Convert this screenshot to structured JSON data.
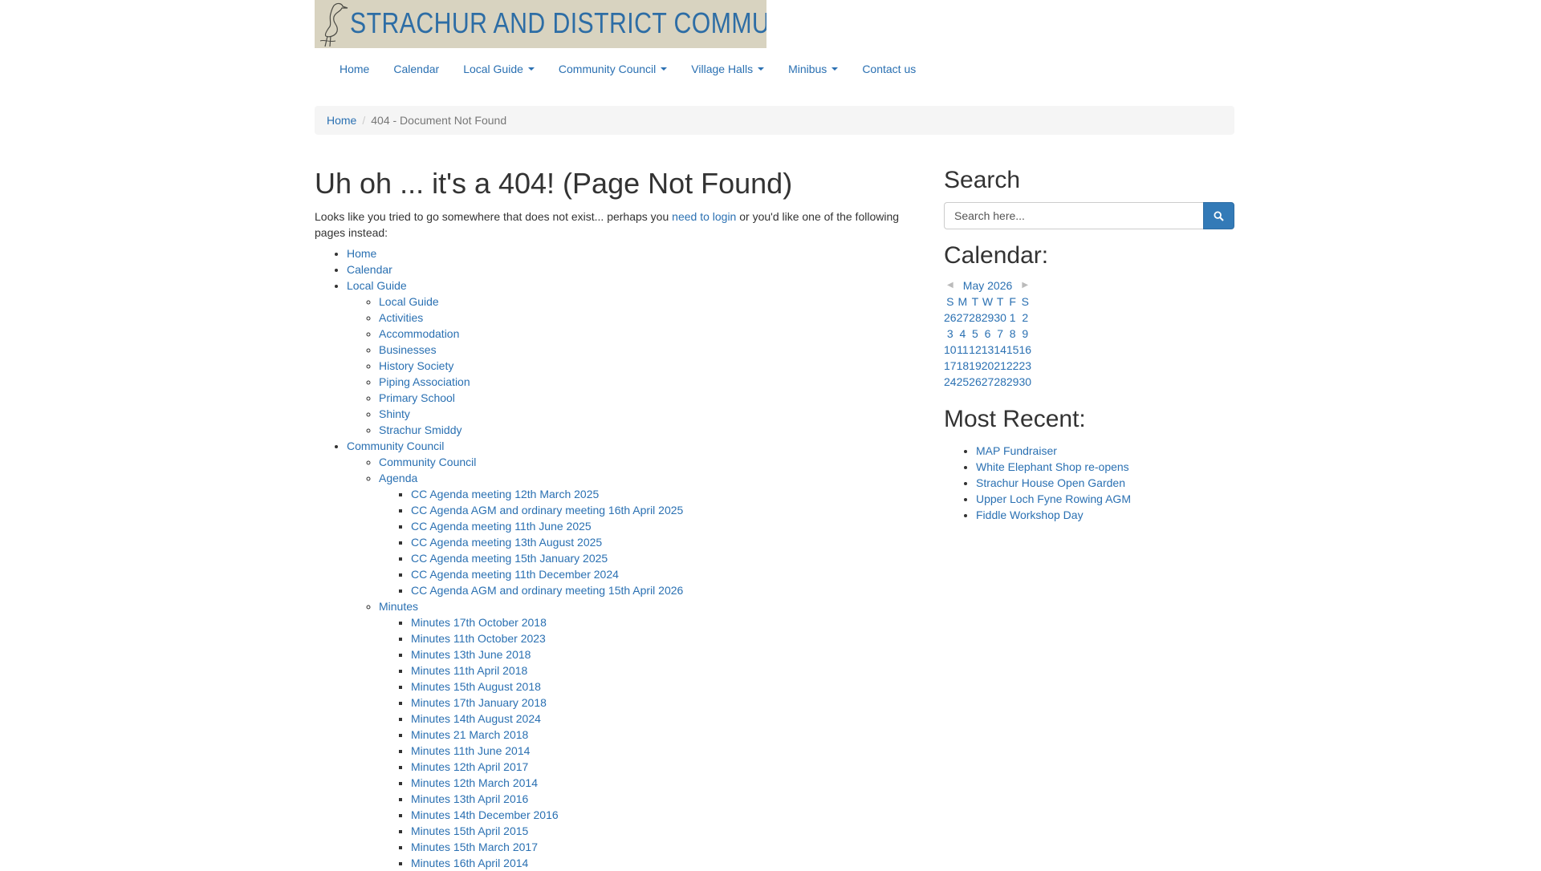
{
  "site": {
    "title": "STRACHUR AND DISTRICT COMMUNITY",
    "logo_icon": "heron-icon"
  },
  "nav": [
    {
      "label": "Home",
      "dropdown": false
    },
    {
      "label": "Calendar",
      "dropdown": false
    },
    {
      "label": "Local Guide",
      "dropdown": true
    },
    {
      "label": "Community Council",
      "dropdown": true
    },
    {
      "label": "Village Halls",
      "dropdown": true
    },
    {
      "label": "Minibus",
      "dropdown": true
    },
    {
      "label": "Contact us",
      "dropdown": false
    }
  ],
  "breadcrumb": {
    "home": "Home",
    "current": "404 - Document Not Found"
  },
  "main": {
    "title": "Uh oh ... it's a 404! (Page Not Found)",
    "intro_before": "Looks like you tried to go somewhere that does not exist... perhaps you ",
    "intro_link": "need to login",
    "intro_after": " or you'd like one of the following pages instead:",
    "tree": {
      "home": "Home",
      "calendar": "Calendar",
      "local_guide": "Local Guide",
      "local_guide_items": [
        "Local Guide",
        "Activities",
        "Accommodation",
        "Businesses",
        "History Society",
        "Piping Association",
        "Primary School",
        "Shinty",
        "Strachur Smiddy"
      ],
      "community_council": "Community Council",
      "cc_page": "Community Council",
      "agenda": "Agenda",
      "agenda_items": [
        "CC Agenda meeting 12th March 2025",
        "CC Agenda AGM and ordinary meeting 16th April 2025",
        "CC Agenda meeting 11th June 2025",
        "CC Agenda meeting 13th August 2025",
        "CC Agenda meeting 15th January 2025",
        "CC Agenda meeting 11th December 2024",
        "CC Agenda AGM and ordinary meeting 15th April 2026"
      ],
      "minutes": "Minutes",
      "minutes_items": [
        "Minutes 17th October 2018",
        "Minutes 11th October 2023",
        "Minutes 13th June 2018",
        "Minutes 11th April 2018",
        "Minutes 15th August 2018",
        "Minutes 17th January 2018",
        "Minutes 14th August 2024",
        "Minutes 21 March 2018",
        "Minutes 11th June 2014",
        "Minutes 12th April 2017",
        "Minutes 12th March 2014",
        "Minutes 13th April 2016",
        "Minutes 14th December 2016",
        "Minutes 15th April 2015",
        "Minutes 15th March 2017",
        "Minutes 16th April 2014"
      ]
    }
  },
  "sidebar": {
    "search_heading": "Search",
    "search_placeholder": "Search here...",
    "search_icon": "search-icon",
    "calendar_heading": "Calendar:",
    "calendar": {
      "month": "May 2026",
      "prev_icon": "caret-left-icon",
      "next_icon": "caret-right-icon",
      "weekdays": [
        "S",
        "M",
        "T",
        "W",
        "T",
        "F",
        "S"
      ],
      "weeks": [
        [
          "26",
          "27",
          "28",
          "29",
          "30",
          "1",
          "2"
        ],
        [
          "3",
          "4",
          "5",
          "6",
          "7",
          "8",
          "9"
        ],
        [
          "10",
          "11",
          "12",
          "13",
          "14",
          "15",
          "16"
        ],
        [
          "17",
          "18",
          "19",
          "20",
          "21",
          "22",
          "23"
        ],
        [
          "24",
          "25",
          "26",
          "27",
          "28",
          "29",
          "30"
        ]
      ]
    },
    "recent_heading": "Most Recent:",
    "recent": [
      "MAP Fundraiser",
      "White Elephant Shop re-opens",
      "Strachur House Open Garden",
      "Upper Loch Fyne Rowing AGM",
      "Fiddle Workshop Day"
    ]
  },
  "colors": {
    "link": "#2a70b2",
    "button": "#337ab7",
    "banner_bg": "#d8d3c0",
    "banner_text": "#2d6da5"
  }
}
